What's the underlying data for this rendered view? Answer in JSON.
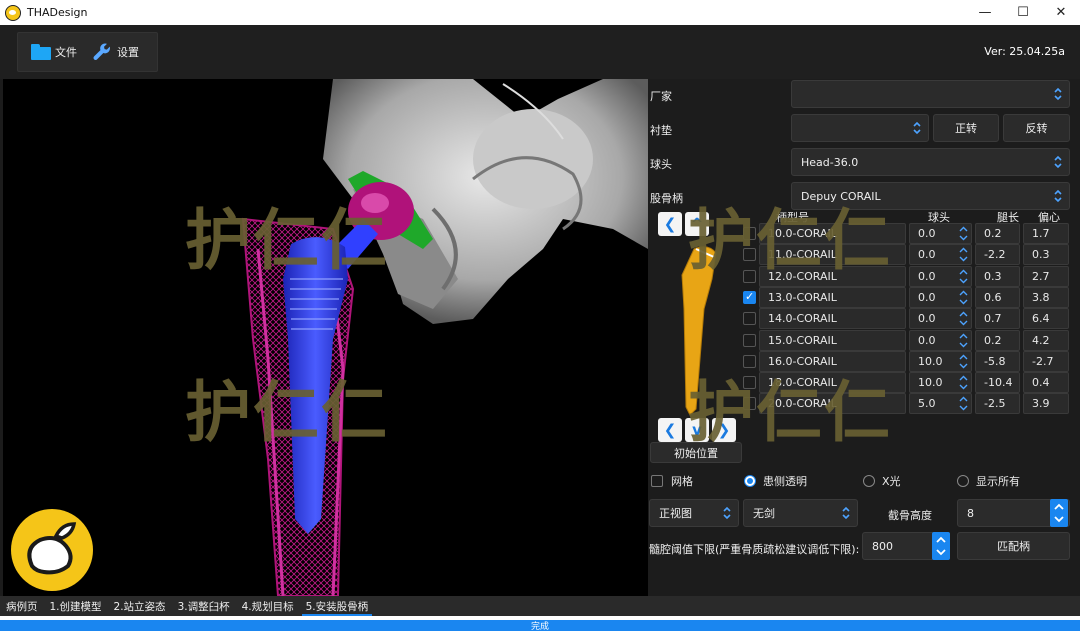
{
  "window": {
    "title": "THADesign",
    "buttons": [
      "—",
      "☐",
      "✕"
    ]
  },
  "toolbar": {
    "file_label": "文件",
    "settings_label": "设置",
    "version": "Ver: 25.04.25a"
  },
  "viewport": {
    "watermark": "护仁仁"
  },
  "panel": {
    "manufacturer_label": "厂家",
    "manufacturer_value": "",
    "liner_label": "衬垫",
    "liner_value": "",
    "rotate_cw": "正转",
    "rotate_ccw": "反转",
    "head_label": "球头",
    "head_value": "Head-36.0",
    "stem_label": "股骨柄",
    "stem_value": "Depuy CORAIL",
    "initial_position": "初始位置"
  },
  "table": {
    "headers": {
      "model": "柄型号",
      "head": "球头",
      "neck": "腿长",
      "offset": "偏心"
    },
    "rows": [
      {
        "model": "10.0-CORAIL",
        "head": "0.0",
        "neck": "0.2",
        "offset": "1.7",
        "checked": false
      },
      {
        "model": "11.0-CORAIL",
        "head": "0.0",
        "neck": "-2.2",
        "offset": "0.3",
        "checked": false
      },
      {
        "model": "12.0-CORAIL",
        "head": "0.0",
        "neck": "0.3",
        "offset": "2.7",
        "checked": false
      },
      {
        "model": "13.0-CORAIL",
        "head": "0.0",
        "neck": "0.6",
        "offset": "3.8",
        "checked": true
      },
      {
        "model": "14.0-CORAIL",
        "head": "0.0",
        "neck": "0.7",
        "offset": "6.4",
        "checked": false
      },
      {
        "model": "15.0-CORAIL",
        "head": "0.0",
        "neck": "0.2",
        "offset": "4.2",
        "checked": false
      },
      {
        "model": "16.0-CORAIL",
        "head": "10.0",
        "neck": "-5.8",
        "offset": "-2.7",
        "checked": false
      },
      {
        "model": "18.0-CORAIL",
        "head": "10.0",
        "neck": "-10.4",
        "offset": "0.4",
        "checked": false
      },
      {
        "model": "20.0-CORAIL",
        "head": "5.0",
        "neck": "-2.5",
        "offset": "3.9",
        "checked": false
      }
    ]
  },
  "options": {
    "grid": "网格",
    "opposite_transparent": "患侧透明",
    "xray": "X光",
    "show_all": "显示所有",
    "selected": "患侧透明"
  },
  "controls": {
    "view_value": "正视图",
    "no_cut": "无剑",
    "cut_height_label": "截骨高度",
    "cut_height_value": "8",
    "threshold_label": "髓腔阈值下限(严重骨质疏松建议调低下限):",
    "threshold_value": "800",
    "match_stem": "匹配柄"
  },
  "tabs": [
    "病例页",
    "1.创建模型",
    "2.站立姿态",
    "3.调整臼杯",
    "4.规划目标",
    "5.安装股骨柄"
  ],
  "active_tab": "5.安装股骨柄",
  "status": {
    "text": "完成",
    "progress": 1.0
  },
  "colors": {
    "accent": "#1a86f0",
    "femur": "#b0147a",
    "stem": "#2a3af0",
    "head": "#b0127a",
    "cup": "#1fa82a",
    "template": "#e8a515"
  }
}
